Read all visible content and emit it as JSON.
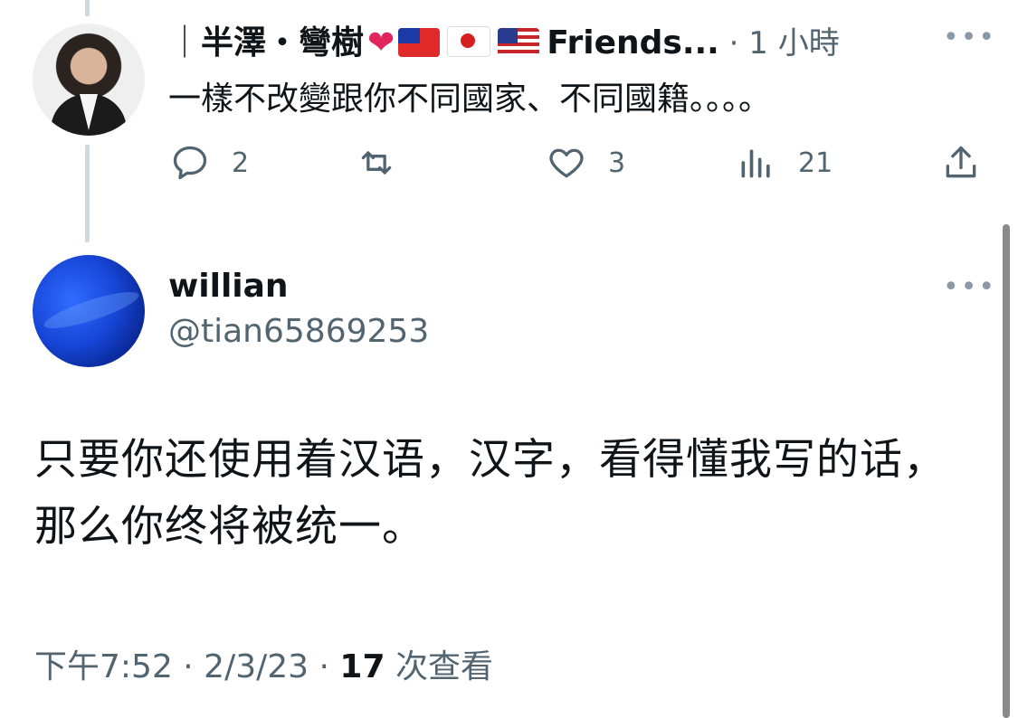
{
  "tweet1": {
    "display_name": "半澤・彎樹",
    "name_tail": "Friends...",
    "timestamp": "1 小時",
    "text": "一樣不改變跟你不同國家、不同國籍。。。。",
    "icons": [
      "heart-emoji",
      "flag-taiwan",
      "flag-japan",
      "flag-us"
    ],
    "actions": {
      "reply_count": "2",
      "retweet_count": "",
      "like_count": "3",
      "view_count": "21"
    }
  },
  "tweet2": {
    "display_name": "willian",
    "handle": "@tian65869253",
    "text": "只要你还使用着汉语，汉字，看得懂我写的话，那么你终将被统一。",
    "meta_time": "下午7:52 · 2/3/23 · ",
    "meta_views": "17",
    "meta_views_label": " 次查看"
  },
  "colors": {
    "text": "#0f1419",
    "secondary": "#536471",
    "thread_line": "#cfd9de"
  }
}
